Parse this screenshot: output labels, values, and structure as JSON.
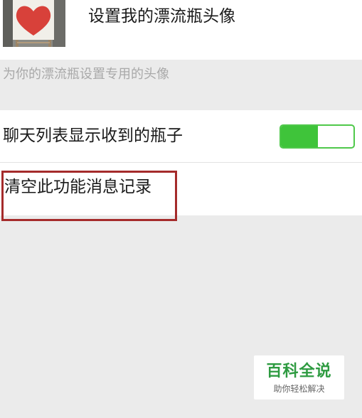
{
  "avatar_section": {
    "label": "设置我的漂流瓶头像",
    "image_icon": "heart-picture-icon",
    "hint": "为你的漂流瓶设置专用的头像"
  },
  "settings": {
    "show_bottles_label": "聊天列表显示收到的瓶子",
    "show_bottles_enabled": true,
    "clear_history_label": "清空此功能消息记录"
  },
  "colors": {
    "toggle_on": "#3fc43a",
    "highlight_border": "#a52b2b",
    "watermark_green": "#2e9b41"
  },
  "watermark": {
    "title": "百科全说",
    "subtitle": "助你轻松解决"
  }
}
